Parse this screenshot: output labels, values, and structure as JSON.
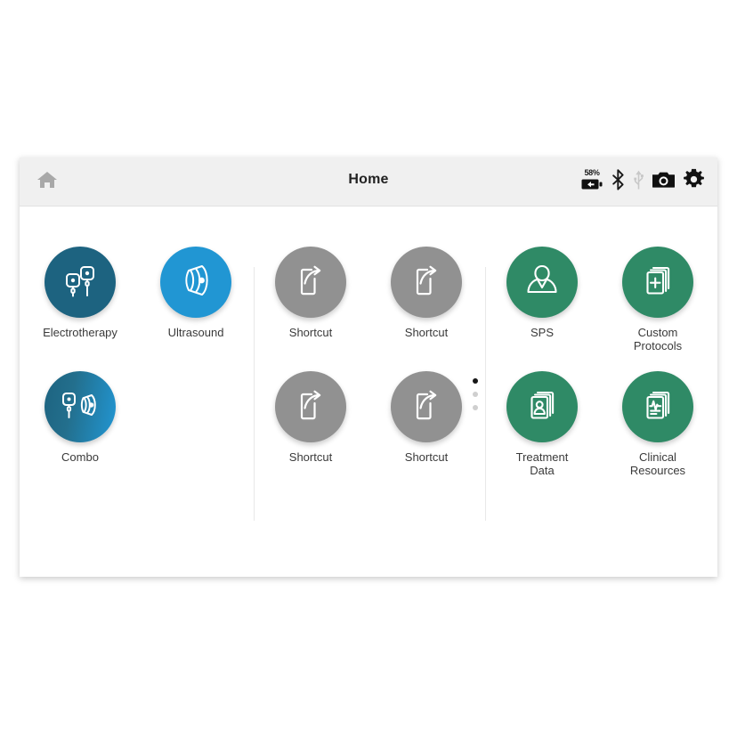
{
  "header": {
    "title": "Home",
    "home_icon": "home-icon",
    "status": {
      "battery_percent": "58%",
      "battery_icon": "battery-charging-icon",
      "bluetooth_icon": "bluetooth-icon",
      "usb_icon": "usb-icon",
      "camera_icon": "camera-icon",
      "settings_icon": "gear-icon"
    }
  },
  "groups": {
    "therapy": [
      {
        "label": "Electrotherapy",
        "icon": "electrode-pads-icon",
        "color": "#1d6380",
        "style": "c-electro"
      },
      {
        "label": "Ultrasound",
        "icon": "ultrasound-transducer-icon",
        "color": "#2196d3",
        "style": "c-ultra"
      },
      {
        "label": "Combo",
        "icon": "combo-electrode-ultrasound-icon",
        "color": "#2196d3",
        "style": "c-combo"
      }
    ],
    "shortcuts": [
      {
        "label": "Shortcut",
        "icon": "shortcut-arrow-icon",
        "color": "#919191"
      },
      {
        "label": "Shortcut",
        "icon": "shortcut-arrow-icon",
        "color": "#919191"
      },
      {
        "label": "Shortcut",
        "icon": "shortcut-arrow-icon",
        "color": "#919191"
      },
      {
        "label": "Shortcut",
        "icon": "shortcut-arrow-icon",
        "color": "#919191"
      }
    ],
    "tools": [
      {
        "label": "SPS",
        "icon": "person-icon",
        "color": "#2f8a66"
      },
      {
        "label": "Custom\nProtocols",
        "icon": "documents-plus-icon",
        "color": "#2f8a66"
      },
      {
        "label": "Treatment\nData",
        "icon": "documents-person-icon",
        "color": "#2f8a66"
      },
      {
        "label": "Clinical\nResources",
        "icon": "documents-ecg-icon",
        "color": "#2f8a66"
      }
    ]
  },
  "pagination": {
    "dots": 3,
    "active_index": 0
  }
}
